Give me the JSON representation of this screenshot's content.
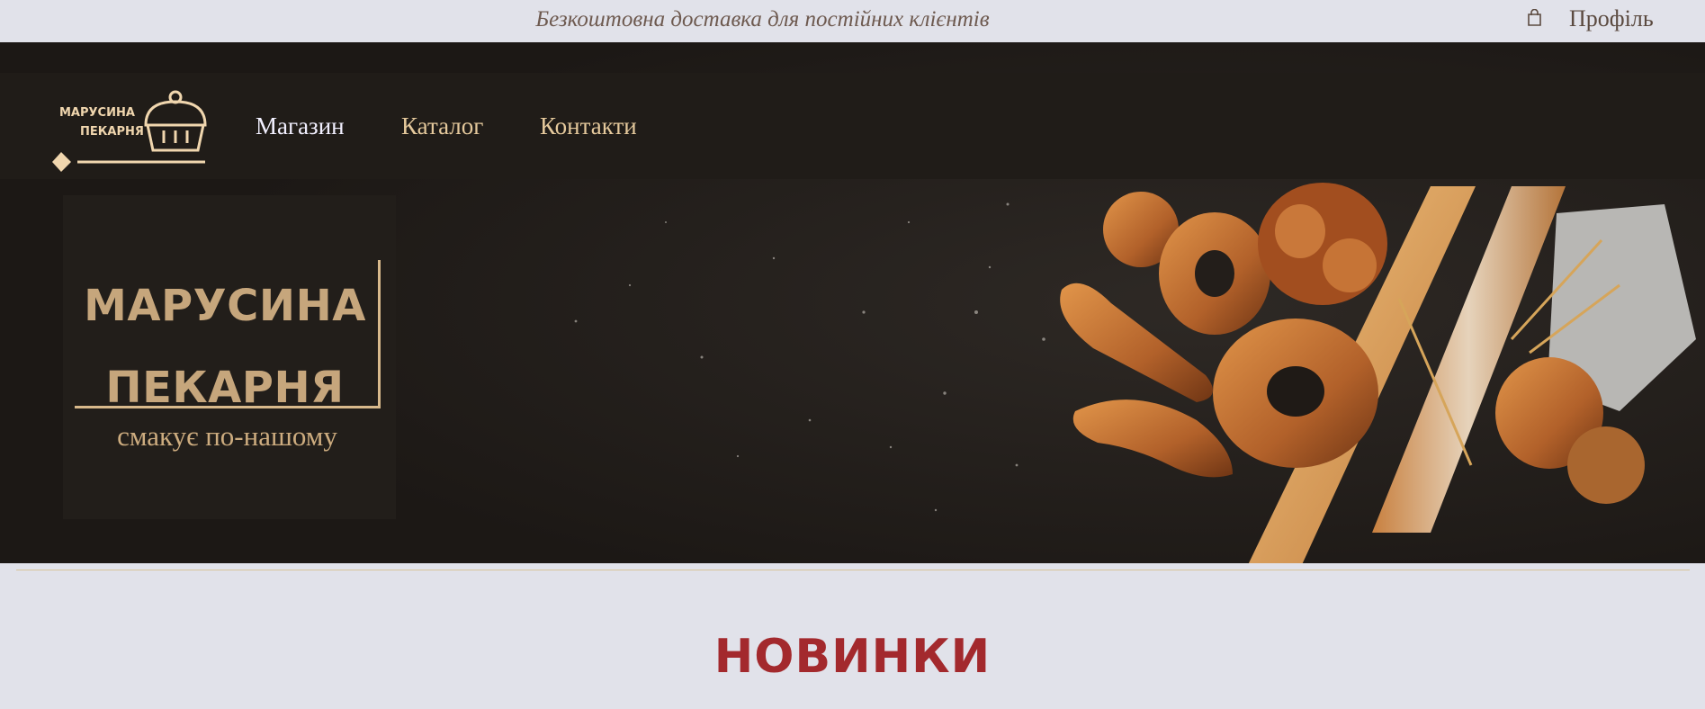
{
  "topbar": {
    "announcement": "Безкоштовна доставка для постійних клієнтів",
    "profile_label": "Профіль",
    "cart_icon": "shopping-bag-icon"
  },
  "logo": {
    "line1": "МАРУСИНА",
    "line2": "ПЕКАРНЯ"
  },
  "nav": {
    "items": [
      {
        "label": "Магазин",
        "active": true
      },
      {
        "label": "Каталог",
        "active": false
      },
      {
        "label": "Контакти",
        "active": false
      }
    ]
  },
  "hero": {
    "title_line1": "МАРУСИНА",
    "title_line2": "ПЕКАРНЯ",
    "tagline": "смакує по-нашому",
    "image": "bakery-breads-image"
  },
  "sections": {
    "new_title": "НОВИНКИ"
  },
  "colors": {
    "page_bg": "#e1e2ea",
    "hero_bg": "#1f1b17",
    "gold": "#d8b98b",
    "accent_red": "#a3292d"
  }
}
